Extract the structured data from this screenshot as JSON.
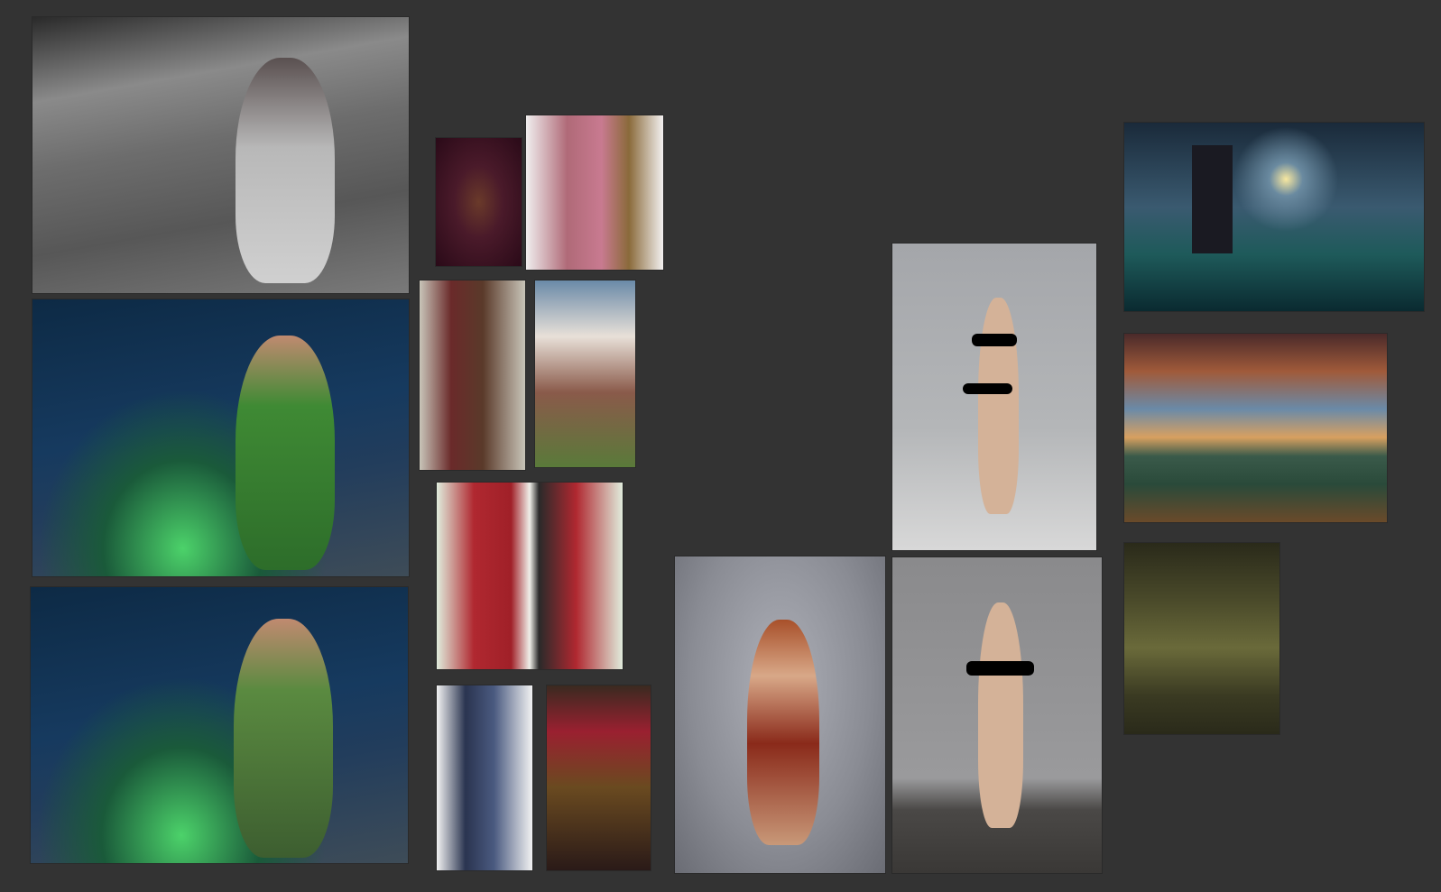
{
  "board": {
    "background": "#333333",
    "image_count": 16
  }
}
